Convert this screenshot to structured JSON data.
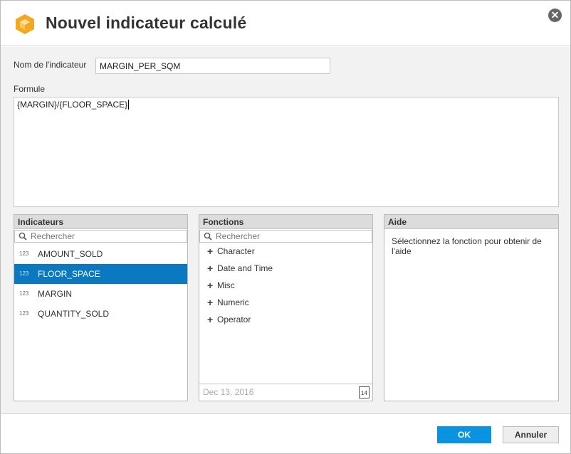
{
  "dialog": {
    "title": "Nouvel indicateur calculé",
    "close_icon": "close-circle-icon",
    "logo_icon": "cube-icon",
    "accent_color": "#0a79bf"
  },
  "form": {
    "name_label": "Nom de l'indicateur",
    "name_value": "MARGIN_PER_SQM",
    "formula_label": "Formule",
    "formula_value": "{MARGIN}/{FLOOR_SPACE}"
  },
  "indicators": {
    "header": "Indicateurs",
    "search_placeholder": "Rechercher",
    "items": [
      {
        "label": "AMOUNT_SOLD",
        "icon": "123",
        "selected": false
      },
      {
        "label": "FLOOR_SPACE",
        "icon": "123",
        "selected": true
      },
      {
        "label": "MARGIN",
        "icon": "123",
        "selected": false
      },
      {
        "label": "QUANTITY_SOLD",
        "icon": "123",
        "selected": false
      }
    ]
  },
  "functions": {
    "header": "Fonctions",
    "search_placeholder": "Rechercher",
    "items": [
      {
        "label": "Character"
      },
      {
        "label": "Date and Time"
      },
      {
        "label": "Misc"
      },
      {
        "label": "Numeric"
      },
      {
        "label": "Operator"
      }
    ],
    "date_placeholder": "Dec 13, 2016",
    "calendar_day": "14"
  },
  "help": {
    "header": "Aide",
    "text": "Sélectionnez la fonction pour obtenir de l'aide"
  },
  "footer": {
    "ok_label": "OK",
    "cancel_label": "Annuler"
  }
}
